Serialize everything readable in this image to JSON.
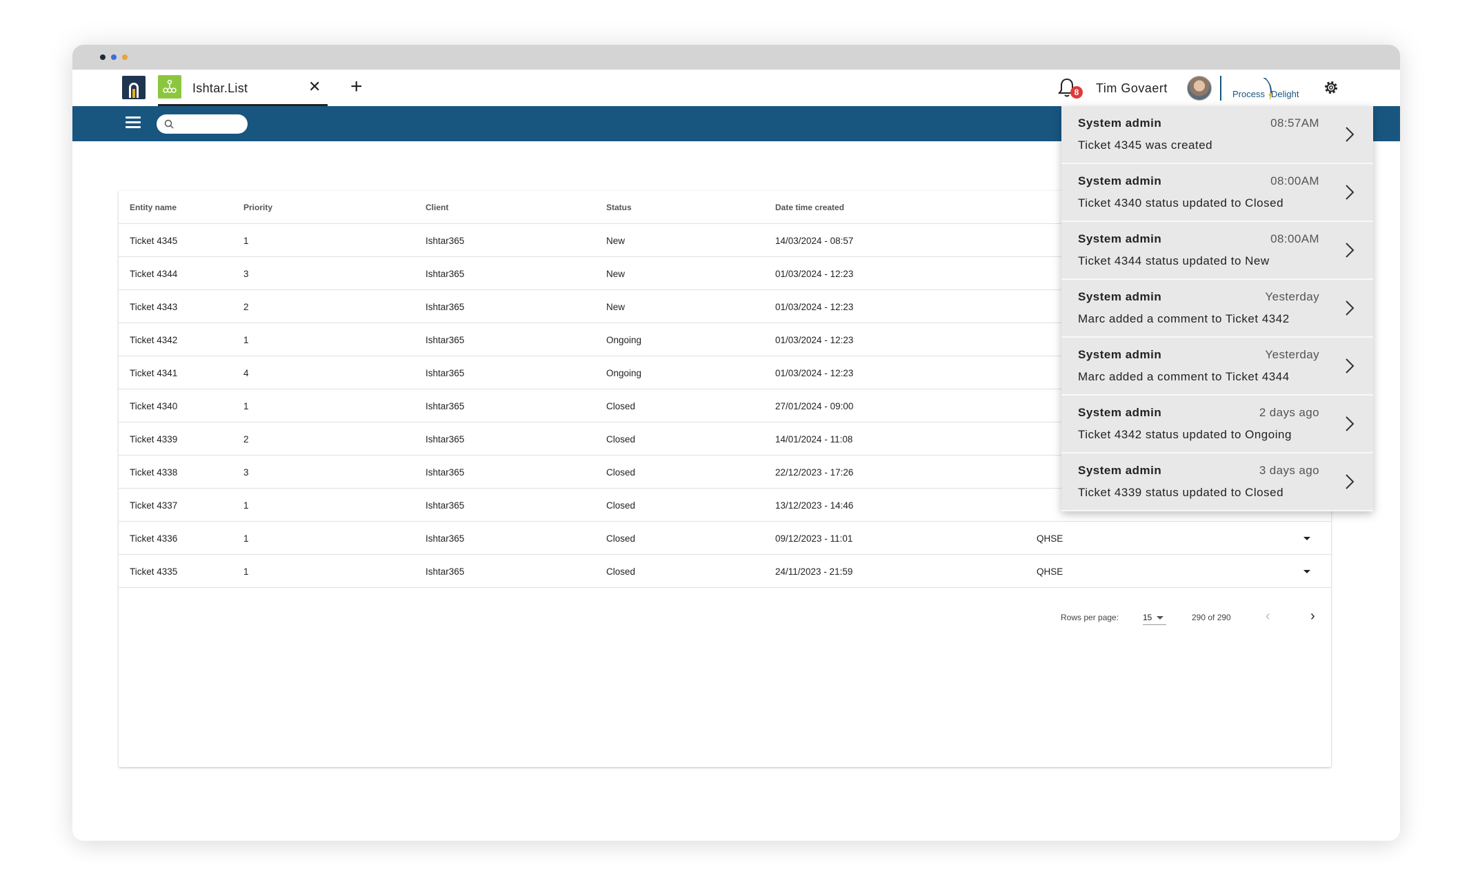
{
  "tab": {
    "label": "Ishtar.List",
    "close": "✕",
    "add": "+"
  },
  "user": {
    "name": "Tim Govaert",
    "notification_count": "8"
  },
  "brand": {
    "part1": "Process",
    "part2": "Delight"
  },
  "table": {
    "columns": [
      "Entity name",
      "Priority",
      "Client",
      "Status",
      "Date time created"
    ],
    "rows": [
      {
        "entity": "Ticket 4345",
        "priority": "1",
        "client": "Ishtar365",
        "status": "New",
        "date": "14/03/2024 - 08:57",
        "dept": ""
      },
      {
        "entity": "Ticket 4344",
        "priority": "3",
        "client": "Ishtar365",
        "status": "New",
        "date": "01/03/2024 - 12:23",
        "dept": ""
      },
      {
        "entity": "Ticket 4343",
        "priority": "2",
        "client": "Ishtar365",
        "status": "New",
        "date": "01/03/2024 - 12:23",
        "dept": ""
      },
      {
        "entity": "Ticket 4342",
        "priority": "1",
        "client": "Ishtar365",
        "status": "Ongoing",
        "date": "01/03/2024 - 12:23",
        "dept": ""
      },
      {
        "entity": "Ticket 4341",
        "priority": "4",
        "client": "Ishtar365",
        "status": "Ongoing",
        "date": "01/03/2024 - 12:23",
        "dept": ""
      },
      {
        "entity": "Ticket 4340",
        "priority": "1",
        "client": "Ishtar365",
        "status": "Closed",
        "date": "27/01/2024 - 09:00",
        "dept": ""
      },
      {
        "entity": "Ticket 4339",
        "priority": "2",
        "client": "Ishtar365",
        "status": "Closed",
        "date": "14/01/2024 - 11:08",
        "dept": ""
      },
      {
        "entity": "Ticket 4338",
        "priority": "3",
        "client": "Ishtar365",
        "status": "Closed",
        "date": "22/12/2023 - 17:26",
        "dept": ""
      },
      {
        "entity": "Ticket 4337",
        "priority": "1",
        "client": "Ishtar365",
        "status": "Closed",
        "date": "13/12/2023 - 14:46",
        "dept": ""
      },
      {
        "entity": "Ticket 4336",
        "priority": "1",
        "client": "Ishtar365",
        "status": "Closed",
        "date": "09/12/2023 - 11:01",
        "dept": "QHSE"
      },
      {
        "entity": "Ticket 4335",
        "priority": "1",
        "client": "Ishtar365",
        "status": "Closed",
        "date": "24/11/2023 - 21:59",
        "dept": "QHSE"
      }
    ]
  },
  "pager": {
    "rows_label": "Rows per page:",
    "rows_value": "15",
    "range": "290 of 290"
  },
  "notifications": [
    {
      "sender": "System admin",
      "time": "08:57AM",
      "message": "Ticket 4345 was created"
    },
    {
      "sender": "System admin",
      "time": "08:00AM",
      "message": "Ticket 4340 status updated to Closed"
    },
    {
      "sender": "System admin",
      "time": "08:00AM",
      "message": "Ticket 4344 status updated to New"
    },
    {
      "sender": "System admin",
      "time": "Yesterday",
      "message": "Marc added a comment to Ticket 4342"
    },
    {
      "sender": "System admin",
      "time": "Yesterday",
      "message": "Marc added a comment to Ticket 4344"
    },
    {
      "sender": "System admin",
      "time": "2 days ago",
      "message": "Ticket 4342 status updated to Ongoing"
    },
    {
      "sender": "System admin",
      "time": "3 days ago",
      "message": "Ticket 4339 status updated to Closed"
    }
  ],
  "colors": {
    "nav": "#185680",
    "tab_icon": "#8cc63f",
    "badge": "#e03a3a"
  },
  "icons": [
    "app-logo-icon",
    "list-app-icon",
    "close-icon",
    "plus-icon",
    "bell-icon",
    "gear-icon",
    "menu-icon",
    "search-icon",
    "chevron-right-icon",
    "caret-down-icon"
  ]
}
